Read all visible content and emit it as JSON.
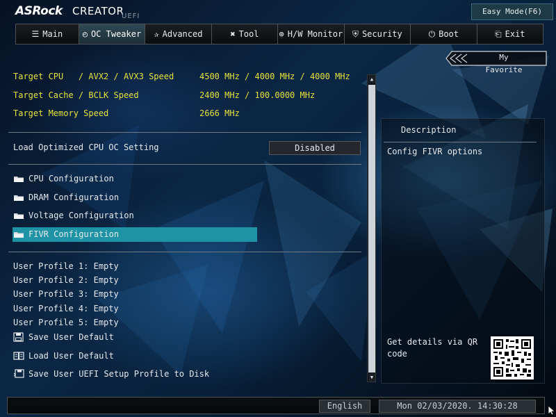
{
  "header": {
    "brand": "ASRock",
    "product": "CREATOR",
    "firmware": "UEFI",
    "easy_mode_label": "Easy Mode(F6)"
  },
  "nav": {
    "tabs": [
      {
        "label": "Main",
        "icon": "list-icon"
      },
      {
        "label": "OC Tweaker",
        "icon": "gauge-icon",
        "active": true
      },
      {
        "label": "Advanced",
        "icon": "star-icon"
      },
      {
        "label": "Tool",
        "icon": "tools-icon"
      },
      {
        "label": "H/W Monitor",
        "icon": "monitor-icon"
      },
      {
        "label": "Security",
        "icon": "shield-icon"
      },
      {
        "label": "Boot",
        "icon": "power-icon"
      },
      {
        "label": "Exit",
        "icon": "exit-icon"
      }
    ]
  },
  "favorite": {
    "label": "My Favorite"
  },
  "targets": [
    {
      "label": "Target CPU   / AVX2 / AVX3 Speed",
      "value": "4500 MHz / 4000 MHz / 4000 MHz"
    },
    {
      "label": "Target Cache / BCLK Speed",
      "value": "2400 MHz / 100.0000 MHz"
    },
    {
      "label": "Target Memory Speed",
      "value": "2666 MHz"
    }
  ],
  "oc_setting": {
    "label": "Load Optimized CPU OC Setting",
    "value": "Disabled"
  },
  "submenus": [
    {
      "label": "CPU Configuration"
    },
    {
      "label": "DRAM Configuration"
    },
    {
      "label": "Voltage Configuration"
    },
    {
      "label": "FIVR Configuration",
      "selected": true
    }
  ],
  "profiles": [
    "User Profile 1: Empty",
    "User Profile 2: Empty",
    "User Profile 3: Empty",
    "User Profile 4: Empty",
    "User Profile 5: Empty"
  ],
  "actions": [
    {
      "label": "Save User Default",
      "icon": "floppy-icon"
    },
    {
      "label": "Load User Default",
      "icon": "book-icon"
    },
    {
      "label": "Save User UEFI Setup Profile to Disk",
      "icon": "save-disk-icon"
    }
  ],
  "description": {
    "title": "Description",
    "text": "Config FIVR options",
    "qr_text": "Get details via QR code"
  },
  "footer": {
    "language": "English",
    "datetime": "Mon 02/03/2020. 14:30:28"
  },
  "colors": {
    "accent": "#1e93a6",
    "target_text": "#e6e13a",
    "text": "#e6e9ee"
  }
}
